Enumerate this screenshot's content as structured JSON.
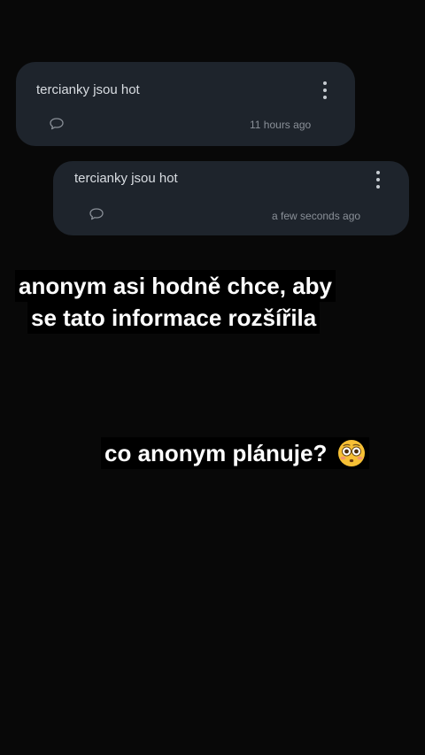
{
  "posts": [
    {
      "text": "tercianky jsou hot",
      "timestamp": "11 hours ago",
      "comment_icon": "comment-icon",
      "menu_icon": "more-vert-icon"
    },
    {
      "text": "tercianky jsou hot",
      "timestamp": "a few seconds ago",
      "comment_icon": "comment-icon",
      "menu_icon": "more-vert-icon"
    }
  ],
  "captions": {
    "line1": "anonym asi hodně chce, aby",
    "line2": "se tato informace rozšířila",
    "question": "co anonym plánuje?",
    "question_emoji": "flushed-face-emoji"
  },
  "colors": {
    "background": "#080808",
    "card": "#1e242c",
    "card_text": "#d9dde2",
    "timestamp": "#8a9098",
    "caption_text": "#ffffff",
    "caption_bg": "#000000"
  }
}
